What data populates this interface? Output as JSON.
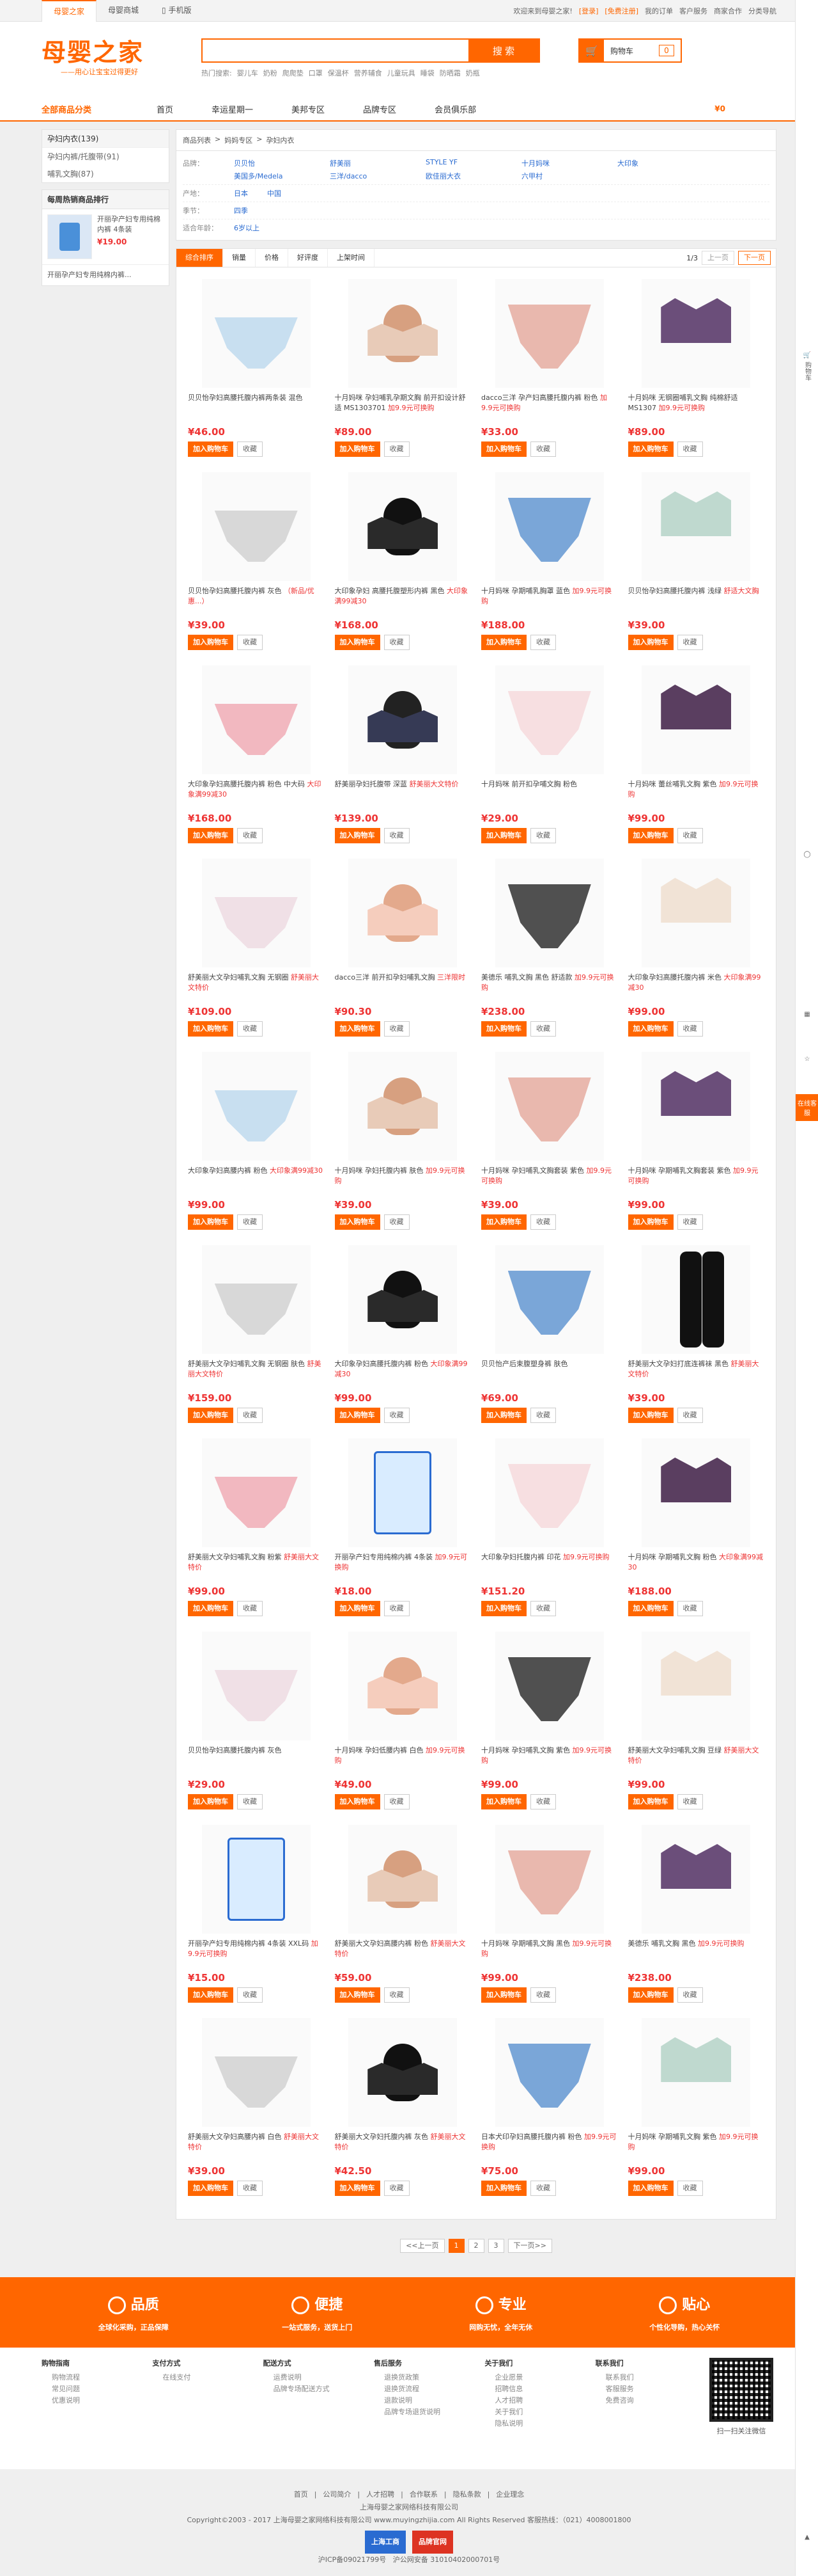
{
  "topbar": {
    "tabs": [
      "母婴之家",
      "母婴商城",
      "手机版"
    ],
    "welcome": "欢迎来到母婴之家!",
    "login": "[登录]",
    "register": "[免费注册]",
    "links": [
      "我的订单",
      "客户服务",
      "商家合作",
      "分类导航"
    ]
  },
  "header": {
    "logo": "母婴之家",
    "slogan": "——用心让宝宝过得更好",
    "search_placeholder": "",
    "search_button": "搜 索",
    "hot_label": "热门搜索:",
    "hot": [
      "婴儿车",
      "奶粉",
      "爬爬垫",
      "口罩",
      "保温杯",
      "营养辅食",
      "儿童玩具",
      "睡袋",
      "防晒霜",
      "奶瓶"
    ],
    "cart_label": "购物车",
    "cart_count": "0"
  },
  "nav": {
    "allcat": "全部商品分类",
    "items": [
      "首页",
      "幸运星期一",
      "美邦专区",
      "品牌专区",
      "会员俱乐部"
    ],
    "right": "¥0"
  },
  "sidebar": {
    "cat_title": "孕妇内衣(139)",
    "cats": [
      "孕妇内裤/托腹带(91)",
      "哺乳文胸(87)"
    ],
    "rank_title": "每周热销商品排行",
    "rank": [
      {
        "name": "开丽孕产妇专用纯棉内裤 4条装",
        "price": "¥19.00"
      },
      {
        "name": "开丽孕产妇专用纯棉内裤...",
        "price": ""
      }
    ]
  },
  "crumb": [
    "商品列表",
    ">",
    "妈妈专区",
    ">",
    "孕妇内衣"
  ],
  "filters": [
    {
      "label": "品牌：",
      "values": [
        "贝贝怡",
        "舒美丽",
        "STYLE YF",
        "十月妈咪",
        "大印象",
        "美国多/Medela",
        "三洋/dacco",
        "欧佳丽大衣",
        "六甲村"
      ]
    },
    {
      "label": "产地：",
      "values": [
        "日本",
        "中国"
      ]
    },
    {
      "label": "季节：",
      "values": [
        "四季"
      ]
    },
    {
      "label": "适合年龄：",
      "values": [
        "6岁以上"
      ]
    }
  ],
  "sort": {
    "items": [
      "综合排序",
      "销量",
      "价格",
      "好评度",
      "上架时间"
    ],
    "page": "1/3",
    "prev": "上一页",
    "next": "下一页"
  },
  "products": [
    {
      "name": "贝贝怡孕妇高腰托腹内裤两条装 混色",
      "tag": "",
      "price": "¥46.00"
    },
    {
      "name": "十月妈咪 孕妇哺乳孕期文胸 前开扣设计舒适 MS1303701",
      "tag": "加9.9元可换购",
      "price": "¥89.00"
    },
    {
      "name": "dacco三洋 孕产妇高腰托腹内裤 粉色",
      "tag": "加9.9元可换购",
      "price": "¥33.00"
    },
    {
      "name": "十月妈咪 无钢圈哺乳文胸 纯棉舒适 MS1307",
      "tag": "加9.9元可换购",
      "price": "¥89.00"
    },
    {
      "name": "贝贝怡孕妇高腰托腹内裤 灰色",
      "tag": "（新品/优惠...）",
      "price": "¥39.00"
    },
    {
      "name": "大印象孕妇 高腰托腹塑形内裤 黑色",
      "tag": "大印象满99减30",
      "price": "¥168.00"
    },
    {
      "name": "十月妈咪 孕期哺乳胸罩 蓝色",
      "tag": "加9.9元可换购",
      "price": "¥188.00"
    },
    {
      "name": "贝贝怡孕妇高腰托腹内裤 浅绿",
      "tag": "舒适大文胸",
      "price": "¥39.00"
    },
    {
      "name": "大印象孕妇高腰托腹内裤 粉色 中大码",
      "tag": "大印象满99减30",
      "price": "¥168.00"
    },
    {
      "name": "舒美丽孕妇托腹带 深蓝",
      "tag": "舒美丽大文特价",
      "price": "¥139.00"
    },
    {
      "name": "十月妈咪 前开扣孕哺文胸 粉色",
      "tag": "",
      "price": "¥29.00"
    },
    {
      "name": "十月妈咪 蕾丝哺乳文胸 紫色",
      "tag": "加9.9元可换购",
      "price": "¥99.00"
    },
    {
      "name": "舒美丽大文孕妇哺乳文胸 无钢圈",
      "tag": "舒美丽大文特价",
      "price": "¥109.00"
    },
    {
      "name": "dacco三洋 前开扣孕妇哺乳文胸",
      "tag": "三洋限时",
      "price": "¥90.30"
    },
    {
      "name": "美德乐 哺乳文胸 黑色 舒适款",
      "tag": "加9.9元可换购",
      "price": "¥238.00"
    },
    {
      "name": "大印象孕妇高腰托腹内裤 米色",
      "tag": "大印象满99减30",
      "price": "¥99.00"
    },
    {
      "name": "大印象孕妇高腰内裤 粉色",
      "tag": "大印象满99减30",
      "price": "¥99.00"
    },
    {
      "name": "十月妈咪 孕妇托腹内裤 肤色",
      "tag": "加9.9元可换购",
      "price": "¥39.00"
    },
    {
      "name": "十月妈咪 孕妇哺乳文胸套装 紫色",
      "tag": "加9.9元可换购",
      "price": "¥39.00"
    },
    {
      "name": "十月妈咪 孕期哺乳文胸套装 紫色",
      "tag": "加9.9元可换购",
      "price": "¥99.00"
    },
    {
      "name": "舒美丽大文孕妇哺乳文胸 无钢圈 肤色",
      "tag": "舒美丽大文特价",
      "price": "¥159.00"
    },
    {
      "name": "大印象孕妇高腰托腹内裤 粉色",
      "tag": "大印象满99减30",
      "price": "¥99.00"
    },
    {
      "name": "贝贝怡产后束腹塑身裤 肤色",
      "tag": "",
      "price": "¥69.00"
    },
    {
      "name": "舒美丽大文孕妇打底连裤袜 黑色",
      "tag": "舒美丽大文特价",
      "price": "¥39.00"
    },
    {
      "name": "舒美丽大文孕妇哺乳文胸 粉紫",
      "tag": "舒美丽大文特价",
      "price": "¥99.00"
    },
    {
      "name": "开丽孕产妇专用纯棉内裤 4条装",
      "tag": "加9.9元可换购",
      "price": "¥18.00"
    },
    {
      "name": "大印象孕妇托腹内裤 印花",
      "tag": "加9.9元可换购",
      "price": "¥151.20"
    },
    {
      "name": "十月妈咪 孕期哺乳文胸 粉色",
      "tag": "大印象满99减30",
      "price": "¥188.00"
    },
    {
      "name": "贝贝怡孕妇高腰托腹内裤 灰色",
      "tag": "",
      "price": "¥29.00"
    },
    {
      "name": "十月妈咪 孕妇低腰内裤 白色",
      "tag": "加9.9元可换购",
      "price": "¥49.00"
    },
    {
      "name": "十月妈咪 孕妇哺乳文胸 紫色",
      "tag": "加9.9元可换购",
      "price": "¥99.00"
    },
    {
      "name": "舒美丽大文孕妇哺乳文胸 豆绿",
      "tag": "舒美丽大文特价",
      "price": "¥99.00"
    },
    {
      "name": "开丽孕产妇专用纯棉内裤 4条装 XXL码",
      "tag": "加9.9元可换购",
      "price": "¥15.00"
    },
    {
      "name": "舒美丽大文孕妇高腰内裤 粉色",
      "tag": "舒美丽大文特价",
      "price": "¥59.00"
    },
    {
      "name": "十月妈咪 孕期哺乳文胸 黑色",
      "tag": "加9.9元可换购",
      "price": "¥99.00"
    },
    {
      "name": "美德乐 哺乳文胸 黑色",
      "tag": "加9.9元可换购",
      "price": "¥238.00"
    },
    {
      "name": "舒美丽大文孕妇高腰内裤 白色",
      "tag": "舒美丽大文特价",
      "price": "¥39.00"
    },
    {
      "name": "舒美丽大文孕妇托腹内裤 灰色",
      "tag": "舒美丽大文特价",
      "price": "¥42.50"
    },
    {
      "name": "日本犬印孕妇高腰托腹内裤 粉色",
      "tag": "加9.9元可换购",
      "price": "¥75.00"
    },
    {
      "name": "十月妈咪 孕期哺乳文胸 紫色",
      "tag": "加9.9元可换购",
      "price": "¥99.00"
    }
  ],
  "buttons": {
    "add": "加入购物车",
    "fav": "收藏"
  },
  "pager": {
    "prev": "<<上一页",
    "pages": [
      "1",
      "2",
      "3"
    ],
    "next": "下一页>>"
  },
  "promise": [
    {
      "title": "品质",
      "sub": "全球化采购，正品保障"
    },
    {
      "title": "便捷",
      "sub": "一站式服务，送货上门"
    },
    {
      "title": "专业",
      "sub": "网购无忧，全年无休"
    },
    {
      "title": "贴心",
      "sub": "个性化导购，热心关怀"
    }
  ],
  "help": [
    {
      "title": "购物指南",
      "items": [
        "购物流程",
        "常见问题",
        "优惠说明"
      ]
    },
    {
      "title": "支付方式",
      "items": [
        "在线支付"
      ]
    },
    {
      "title": "配送方式",
      "items": [
        "运费说明",
        "品牌专场配送方式"
      ]
    },
    {
      "title": "售后服务",
      "items": [
        "退换货政策",
        "退换货流程",
        "退款说明",
        "品牌专场退货说明"
      ]
    },
    {
      "title": "关于我们",
      "items": [
        "企业愿景",
        "招聘信息",
        "人才招聘",
        "关于我们",
        "隐私说明"
      ]
    },
    {
      "title": "联系我们",
      "items": [
        "联系我们",
        "客服服务",
        "免费咨询"
      ]
    }
  ],
  "qr_text": "扫一扫关注微信",
  "footer": {
    "links": [
      "首页",
      "公司简介",
      "人才招聘",
      "合作联系",
      "隐私条款",
      "企业理念"
    ],
    "line1": "上海母婴之家网络科技有限公司",
    "line2": "Copyright©2003 - 2017 上海母婴之家网络科技有限公司 www.muyingzhijia.com All Rights Reserved 客服热线：（021）4008001800",
    "badges": [
      "上海工商",
      "品牌官网"
    ],
    "icp": "沪ICP备09021799号",
    "police": "沪公网安备 31010402000701号"
  },
  "rail": {
    "cart": "购物车",
    "fav": "在线客服"
  },
  "colors": {
    "accent": "#ff6600",
    "price": "#e33333"
  }
}
